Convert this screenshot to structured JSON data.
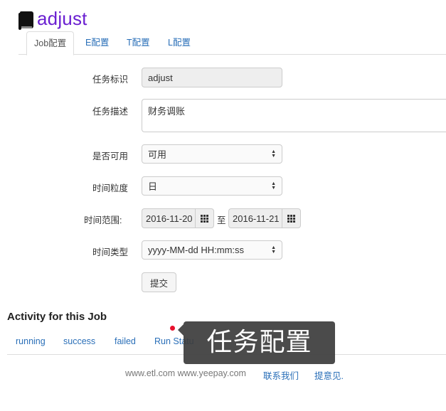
{
  "header": {
    "title": "adjust",
    "icon": "book-icon"
  },
  "tabs": [
    {
      "label": "Job配置",
      "active": true
    },
    {
      "label": "E配置",
      "active": false
    },
    {
      "label": "T配置",
      "active": false
    },
    {
      "label": "L配置",
      "active": false
    }
  ],
  "form": {
    "task_id": {
      "label": "任务标识",
      "value": "adjust"
    },
    "task_desc": {
      "label": "任务描述",
      "value": "财务调账"
    },
    "enabled": {
      "label": "是否可用",
      "value": "可用"
    },
    "granularity": {
      "label": "时间粒度",
      "value": "日"
    },
    "time_range": {
      "label": "时间范围:",
      "start": "2016-11-20",
      "separator": "至",
      "end": "2016-11-21"
    },
    "time_type": {
      "label": "时间类型",
      "value": "yyyy-MM-dd HH:mm:ss"
    },
    "submit_label": "提交"
  },
  "activity": {
    "title": "Activity for this Job",
    "links": [
      "running",
      "success",
      "failed",
      "Run Statu"
    ]
  },
  "footer": {
    "text": "www.etl.com www.yeepay.com",
    "contact": "联系我们",
    "feedback": "提意见."
  },
  "tooltip": {
    "text": "任务配置"
  },
  "colors": {
    "title": "#6a1fd1",
    "link": "#2a6fb8",
    "indicator": "#e8112d"
  }
}
